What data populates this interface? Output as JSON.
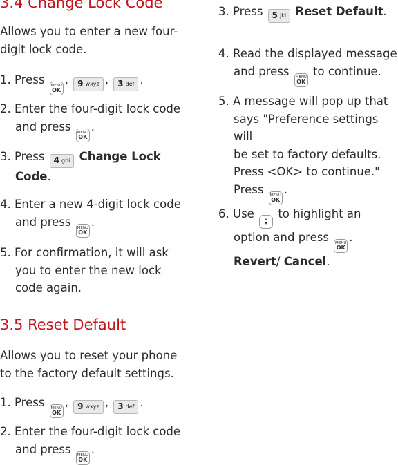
{
  "left": {
    "sec34": {
      "title": "3.4 Change Lock Code",
      "intro": "Allows you to enter a new four-digit lock code.",
      "s1": {
        "num": "1. Press",
        "keys": [
          "MENU OK",
          "9 wxyz",
          "3 def"
        ]
      },
      "s2": {
        "num": "2. Enter the four-digit lock code",
        "cont": "and press"
      },
      "s3": {
        "num": "3. Press",
        "key": "4 ghi",
        "bold1": "Change Lock",
        "bold2": "Code"
      },
      "s4": {
        "num": "4. Enter a new 4-digit lock code",
        "cont": "and press"
      },
      "s5": {
        "line1": "5. For confirmation, it will ask",
        "line2": "you to enter the new lock",
        "line3": "code again."
      }
    },
    "sec35": {
      "title": "3.5 Reset Default",
      "intro1": "Allows you to reset your phone",
      "intro2": "to the factory default settings.",
      "s1": {
        "num": "1. Press"
      },
      "s2": {
        "num": "2. Enter the four-digit lock code",
        "cont": "and press"
      }
    }
  },
  "right": {
    "s3": {
      "num": "3. Press",
      "key": "5 jkl",
      "bold": "Reset Default"
    },
    "s4": {
      "line1": "4. Read the displayed message",
      "line2a": "and press",
      "line2b": "to continue."
    },
    "s5": {
      "line1": "5. A message will pop up that",
      "line2": "says \"Preference settings will",
      "line3": "be set to factory defaults.",
      "line4": "Press <OK> to continue.\"",
      "line5": "Press"
    },
    "s6": {
      "line1a": "6. Use",
      "line1b": "to highlight an",
      "line2": "option and press",
      "bold1": "Revert",
      "sep": "/ ",
      "bold2": "Cancel"
    }
  },
  "keys": {
    "menu_top": "MENU",
    "menu_bottom": "OK",
    "nine_d": "9",
    "nine_l": "wxyz",
    "three_d": "3",
    "three_l": "def",
    "four_d": "4",
    "four_l": "ghi",
    "five_d": "5",
    "five_l": "jkl"
  }
}
